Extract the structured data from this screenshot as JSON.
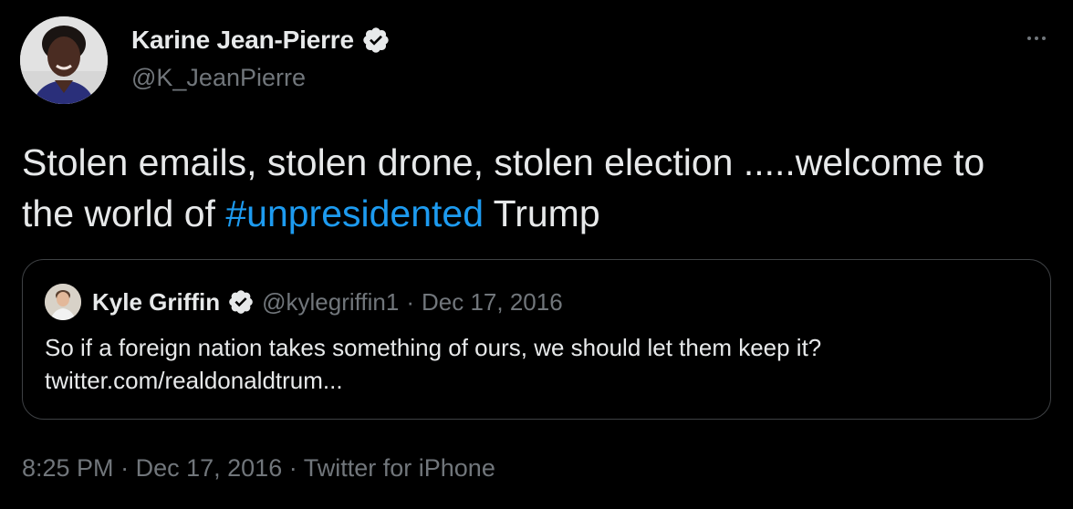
{
  "author": {
    "name": "Karine Jean-Pierre",
    "handle": "@K_JeanPierre",
    "verified_icon": "verified-badge-icon"
  },
  "more_icon": "more-horizontal-icon",
  "tweet": {
    "text_before": "Stolen emails, stolen drone, stolen election .....welcome to the world of ",
    "hashtag": "#unpresidented",
    "text_after": " Trump"
  },
  "quote": {
    "name": "Kyle Griffin",
    "handle": "@kylegriffin1",
    "separator": "·",
    "date": "Dec 17, 2016",
    "text": "So if a foreign nation takes something of ours, we should let them keep it?",
    "link": "twitter.com/realdonaldtrum..."
  },
  "meta": {
    "time": "8:25 PM",
    "separator": "·",
    "date": "Dec 17, 2016",
    "source": "Twitter for iPhone"
  },
  "colors": {
    "background": "#000000",
    "text": "#e7e9ea",
    "secondary": "#71767b",
    "link": "#1d9bf0",
    "border": "#3e4144"
  }
}
